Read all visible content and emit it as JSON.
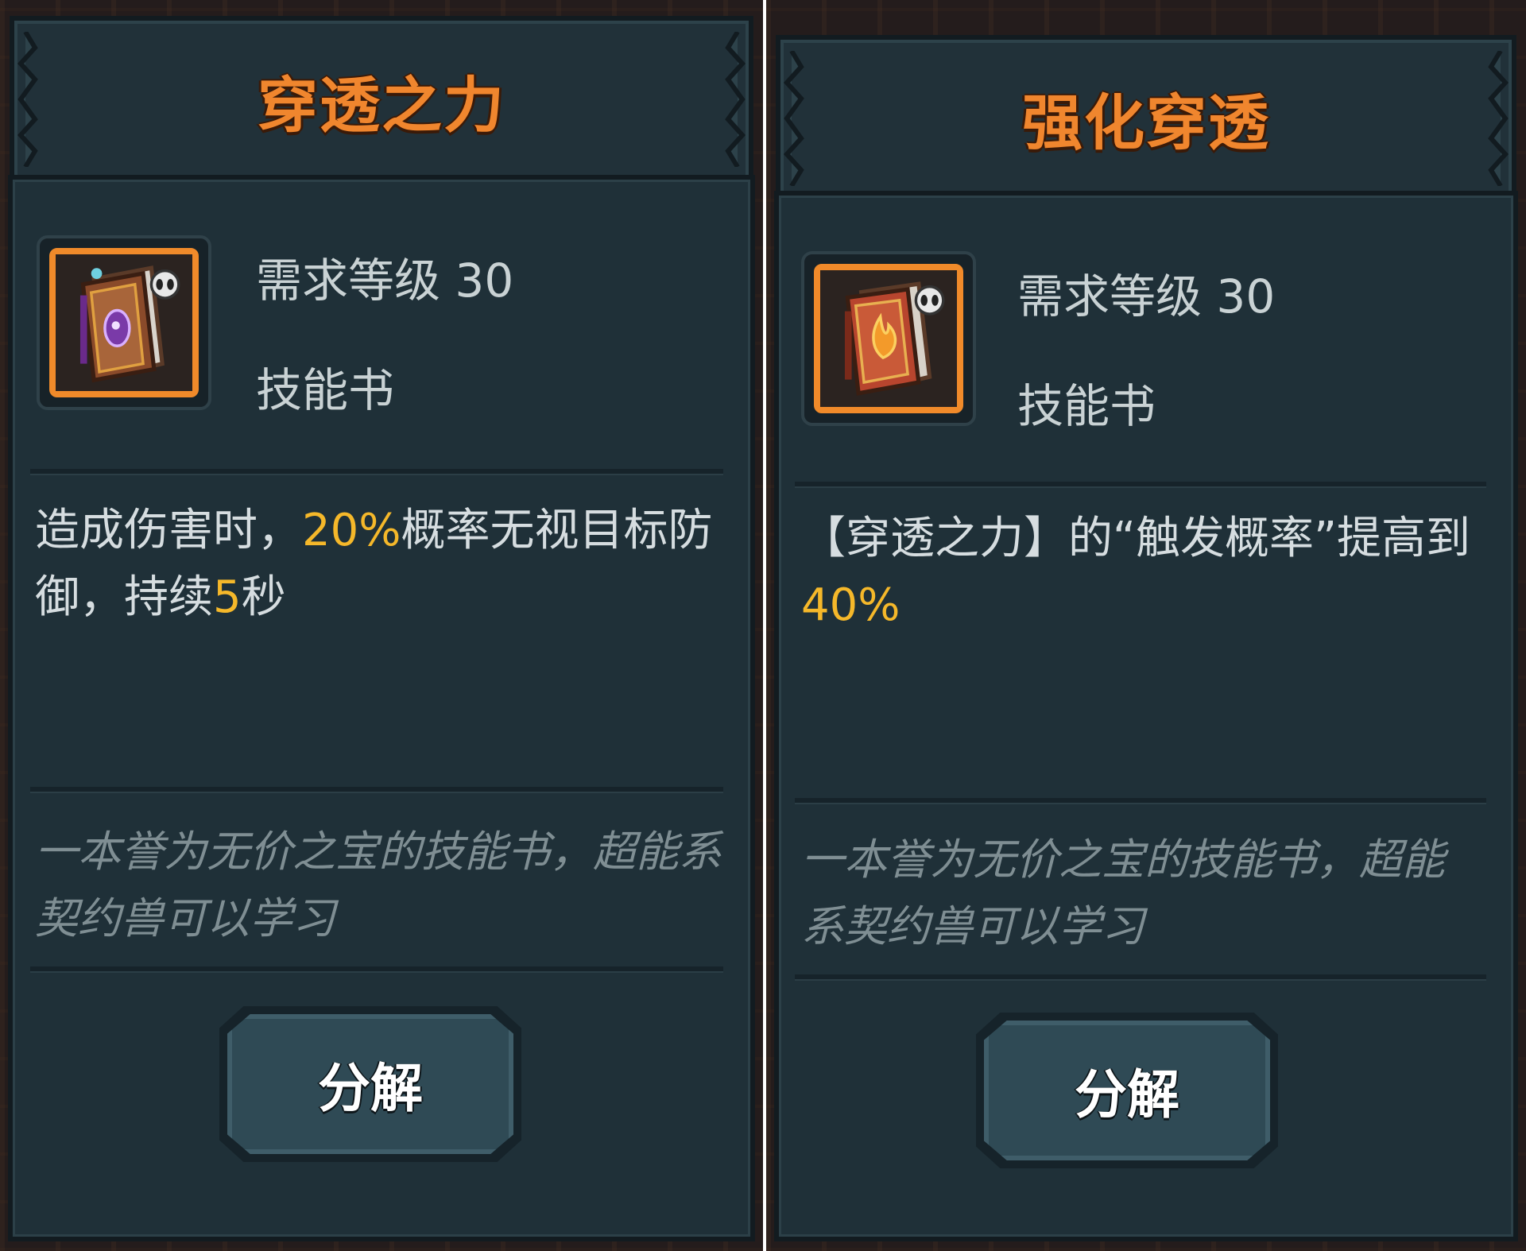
{
  "cards": [
    {
      "title": "穿透之力",
      "level_text": "需求等级 30",
      "type": "技能书",
      "desc_parts": [
        "造成伤害时，",
        "20%",
        "概率无视目标防御，持续",
        "5",
        "秒"
      ],
      "flavor": "一本誉为无价之宝的技能书，超能系契约兽可以学习",
      "button": "分解",
      "icon": "purple-gem-skill-book-icon"
    },
    {
      "title": "强化穿透",
      "level_text": "需求等级 30",
      "type": "技能书",
      "desc_parts": [
        "【穿透之力】的“触发概率”提高到",
        "40%"
      ],
      "flavor": "一本誉为无价之宝的技能书，超能系契约兽可以学习",
      "button": "分解",
      "icon": "red-flame-skill-book-icon"
    }
  ],
  "colors": {
    "title": "#f0862e",
    "highlight": "#f5b82a",
    "icon_border": "#f08a2a",
    "panel": "#1f3038"
  }
}
